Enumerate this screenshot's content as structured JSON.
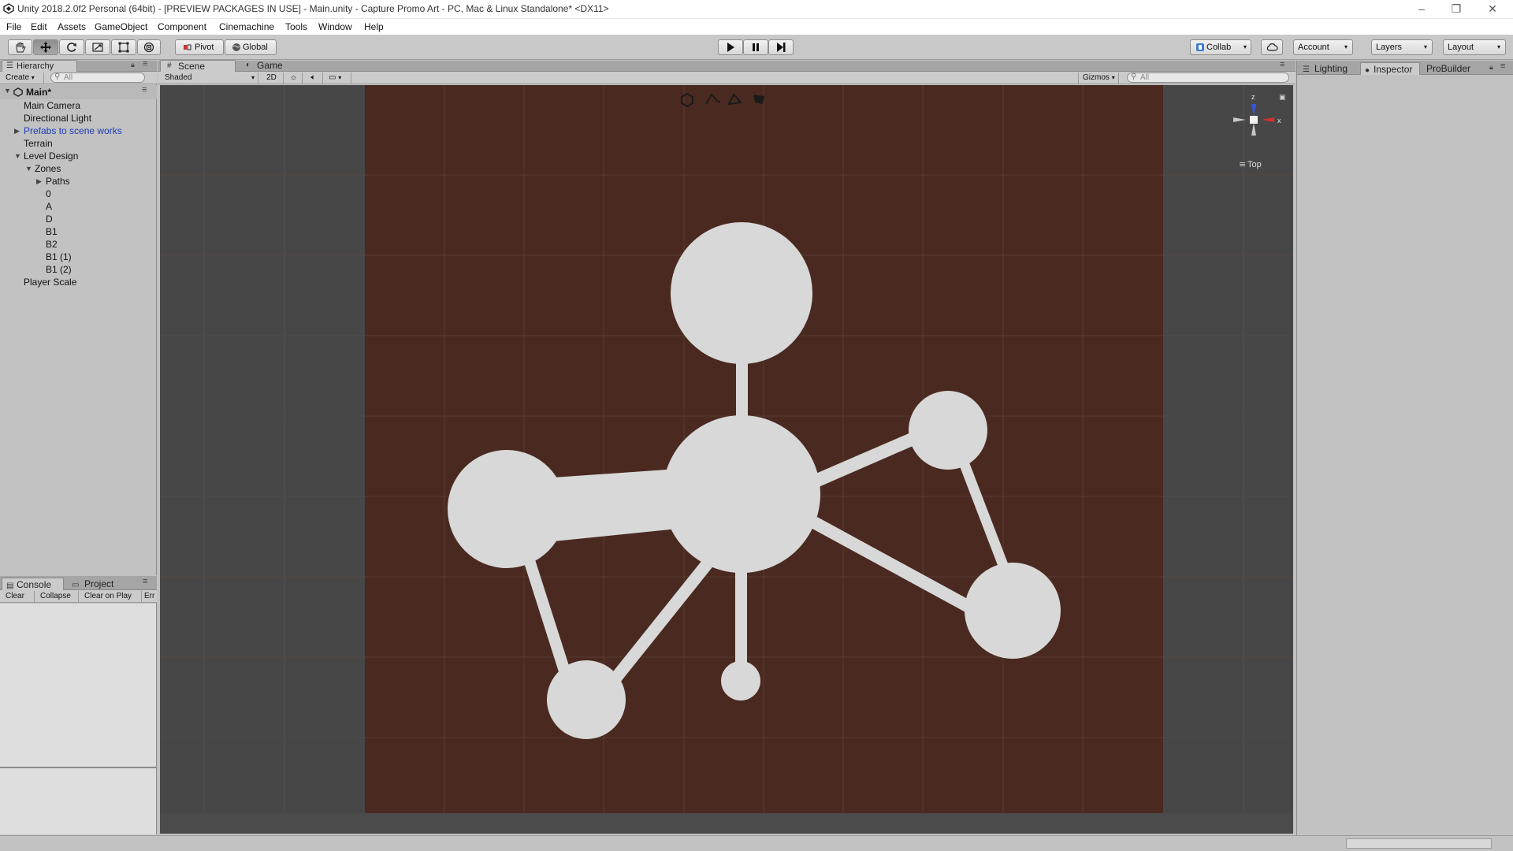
{
  "window": {
    "title": "Unity 2018.2.0f2 Personal (64bit) - [PREVIEW PACKAGES IN USE] - Main.unity - Capture Promo Art - PC, Mac & Linux Standalone* <DX11>",
    "minimize_glyph": "–",
    "restore_glyph": "❐",
    "close_glyph": "✕"
  },
  "menu": [
    "File",
    "Edit",
    "Assets",
    "GameObject",
    "Component",
    "Cinemachine",
    "Tools",
    "Window",
    "Help"
  ],
  "toolbar": {
    "pivot_label": "Pivot",
    "global_label": "Global",
    "collab_label": "Collab",
    "account_label": "Account",
    "layers_label": "Layers",
    "layout_label": "Layout",
    "tools": [
      "hand-tool",
      "move-tool",
      "rotate-tool",
      "scale-tool",
      "rect-tool",
      "transform-tool"
    ],
    "active_tool": "move-tool"
  },
  "hierarchy": {
    "tab_label": "Hierarchy",
    "create_label": "Create",
    "search_placeholder": "All",
    "scene_name": "Main*",
    "items": [
      {
        "label": "Main Camera",
        "depth": 0
      },
      {
        "label": "Directional Light",
        "depth": 0
      },
      {
        "label": "Prefabs to scene works",
        "depth": 0,
        "expander": "collapsed",
        "prefab": true
      },
      {
        "label": "Terrain",
        "depth": 0
      },
      {
        "label": "Level Design",
        "depth": 0,
        "expander": "expanded"
      },
      {
        "label": "Zones",
        "depth": 1,
        "expander": "expanded"
      },
      {
        "label": "Paths",
        "depth": 2,
        "expander": "collapsed"
      },
      {
        "label": "0",
        "depth": 2
      },
      {
        "label": "A",
        "depth": 2
      },
      {
        "label": "D",
        "depth": 2
      },
      {
        "label": "B1",
        "depth": 2
      },
      {
        "label": "B2",
        "depth": 2
      },
      {
        "label": "B1 (1)",
        "depth": 2
      },
      {
        "label": "B1 (2)",
        "depth": 2
      },
      {
        "label": "Player Scale",
        "depth": 0
      }
    ]
  },
  "console": {
    "console_tab": "Console",
    "project_tab": "Project",
    "clear_label": "Clear",
    "collapse_label": "Collapse",
    "clear_on_play_label": "Clear on Play",
    "error_pause_label": "Err"
  },
  "scene": {
    "scene_tab": "Scene",
    "game_tab": "Game",
    "shading_mode": "Shaded",
    "mode_2d_label": "2D",
    "gizmos_label": "Gizmos",
    "search_placeholder": "All",
    "gizmo_axis_z": "z",
    "gizmo_axis_x": "x",
    "view_label": "Top",
    "colors": {
      "ground": "#4a2a20",
      "outside": "#474747",
      "shapes": "#d8d8d8",
      "grid": "#5d5d5d"
    }
  },
  "inspector": {
    "lighting_tab": "Lighting",
    "inspector_tab": "Inspector",
    "probuilder_tab": "ProBuilder"
  }
}
